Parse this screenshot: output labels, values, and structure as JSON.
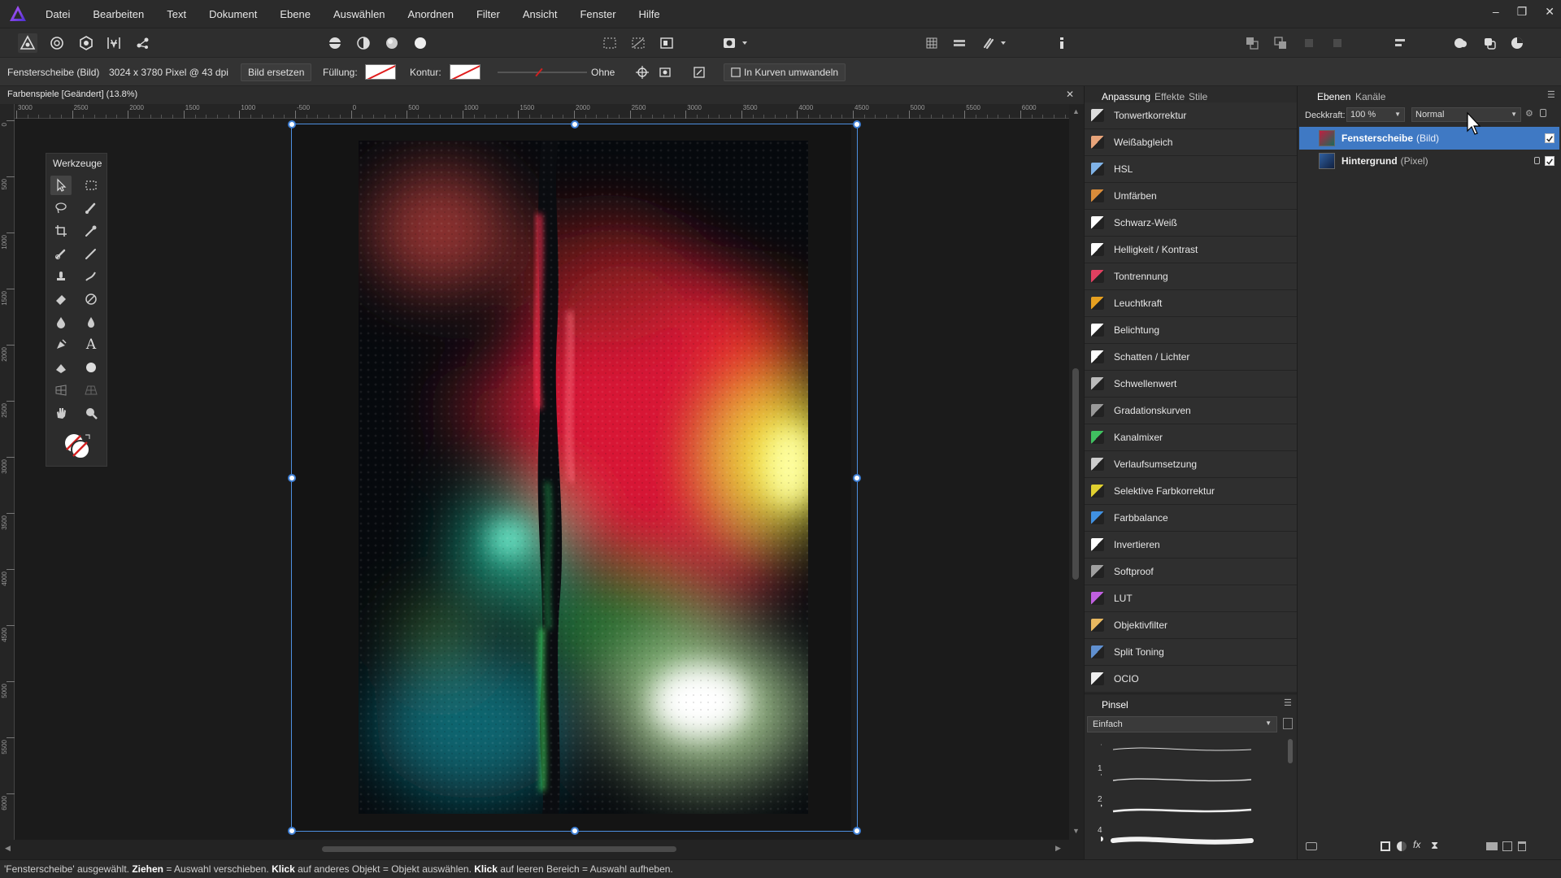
{
  "menu": [
    "Datei",
    "Bearbeiten",
    "Text",
    "Dokument",
    "Ebene",
    "Auswählen",
    "Anordnen",
    "Filter",
    "Ansicht",
    "Fenster",
    "Hilfe"
  ],
  "window_controls": [
    "–",
    "❐",
    "✕"
  ],
  "context": {
    "layer_name": "Fensterscheibe (Bild)",
    "image_info": "3024 x 3780 Pixel @ 43 dpi",
    "replace_button": "Bild ersetzen",
    "fill_label": "Füllung:",
    "stroke_label": "Kontur:",
    "stroke_width_value": "Ohne",
    "convert_button": "In Kurven umwandeln"
  },
  "document": {
    "tab_title": "Farbenspiele [Geändert] (13.8%)",
    "close": "✕"
  },
  "ruler": {
    "h_labels": [
      "3000",
      "2500",
      "2000",
      "1500",
      "1000",
      "-500",
      "0",
      "500",
      "1000",
      "1500",
      "2000",
      "2500",
      "3000",
      "3500",
      "4000",
      "4500",
      "5000",
      "5500",
      "6000"
    ],
    "v_labels": [
      "0",
      "500",
      "1000",
      "1500",
      "2000",
      "2500",
      "3000",
      "3500",
      "4000",
      "4500",
      "5000",
      "5500",
      "6000"
    ]
  },
  "tools_panel": {
    "title": "Werkzeuge"
  },
  "adjust_panel": {
    "tabs": [
      "Anpassung",
      "Effekte",
      "Stile"
    ],
    "items": [
      {
        "label": "Tonwertkorrektur",
        "color": "#dddddd"
      },
      {
        "label": "Weißabgleich",
        "color": "#e8a47a"
      },
      {
        "label": "HSL",
        "color": "#7fb2e6"
      },
      {
        "label": "Umfärben",
        "color": "#d98c3a"
      },
      {
        "label": "Schwarz-Weiß",
        "color": "#ffffff"
      },
      {
        "label": "Helligkeit / Kontrast",
        "color": "#ffffff"
      },
      {
        "label": "Tontrennung",
        "color": "#e04060"
      },
      {
        "label": "Leuchtkraft",
        "color": "#e6a020"
      },
      {
        "label": "Belichtung",
        "color": "#ffffff"
      },
      {
        "label": "Schatten / Lichter",
        "color": "#ffffff"
      },
      {
        "label": "Schwellenwert",
        "color": "#bbbbbb"
      },
      {
        "label": "Gradationskurven",
        "color": "#999999"
      },
      {
        "label": "Kanalmixer",
        "color": "#40c060"
      },
      {
        "label": "Verlaufsumsetzung",
        "color": "#cccccc"
      },
      {
        "label": "Selektive Farbkorrektur",
        "color": "#e0d030"
      },
      {
        "label": "Farbbalance",
        "color": "#4090e0"
      },
      {
        "label": "Invertieren",
        "color": "#ffffff"
      },
      {
        "label": "Softproof",
        "color": "#a0a0a0"
      },
      {
        "label": "LUT",
        "color": "#c060e0"
      },
      {
        "label": "Objektivfilter",
        "color": "#e8b860"
      },
      {
        "label": "Split Toning",
        "color": "#6090d0"
      },
      {
        "label": "OCIO",
        "color": "#eeeeee"
      }
    ]
  },
  "brush_panel": {
    "title": "Pinsel",
    "category": "Einfach",
    "sizes": [
      "1",
      "2",
      "4"
    ]
  },
  "layers_panel": {
    "tabs": [
      "Ebenen",
      "Kanäle"
    ],
    "opacity_label": "Deckkraft:",
    "opacity_value": "100 %",
    "blend_mode": "Normal",
    "layers": [
      {
        "name": "Fensterscheibe",
        "type": "(Bild)",
        "selected": true
      },
      {
        "name": "Hintergrund",
        "type": "(Pixel)",
        "selected": false
      }
    ]
  },
  "status": {
    "s1": "'Fensterscheibe' ausgewählt. ",
    "b1": "Ziehen",
    "s2": " = Auswahl verschieben. ",
    "b2": "Klick",
    "s3": " auf anderes Objekt = Objekt auswählen. ",
    "b3": "Klick",
    "s4": " auf leeren Bereich = Auswahl aufheben."
  },
  "colors": {
    "accent": "#4d8fe0",
    "selection_row": "#3f79c4"
  }
}
